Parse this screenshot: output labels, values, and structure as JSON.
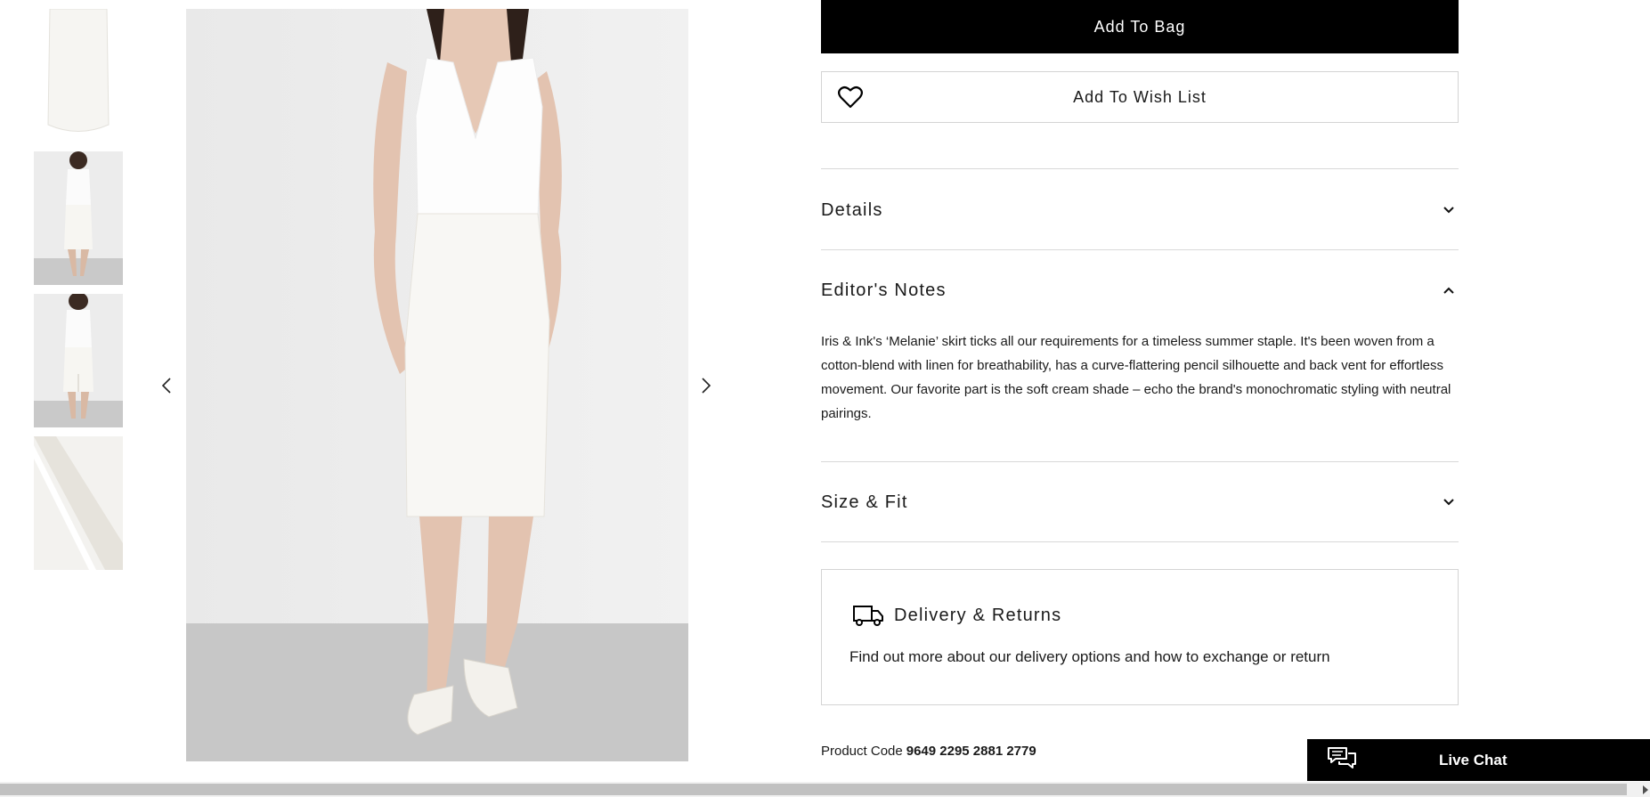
{
  "gallery": {
    "thumbnails": [
      {
        "alt": "skirt front detail"
      },
      {
        "alt": "model front view"
      },
      {
        "alt": "model back view"
      },
      {
        "alt": "fabric close-up"
      }
    ],
    "prev_icon": "chevron-left-icon",
    "next_icon": "chevron-right-icon"
  },
  "actions": {
    "add_to_bag": "Add To Bag",
    "add_to_wish_list": "Add To Wish List",
    "wish_icon": "heart-icon"
  },
  "accordion": {
    "details": {
      "title": "Details",
      "expanded": false
    },
    "editors_notes": {
      "title": "Editor's Notes",
      "expanded": true,
      "body": "Iris & Ink's ‘Melanie’ skirt ticks all our requirements for a timeless summer staple. It's been woven from a cotton-blend with linen for breathability, has a curve-flattering pencil silhouette and back vent for effortless movement. Our favorite part is the soft cream shade – echo the brand's monochromatic styling with neutral pairings."
    },
    "size_fit": {
      "title": "Size & Fit",
      "expanded": false
    }
  },
  "delivery": {
    "title": "Delivery & Returns",
    "text": "Find out more about our delivery options and how to exchange or return",
    "icon": "truck-icon"
  },
  "product_code": {
    "label": "Product Code",
    "value": "9649 2295 2881 2779"
  },
  "chat": {
    "label": "Live Chat",
    "icon": "chat-bubbles-icon"
  },
  "colors": {
    "primary": "#000000",
    "border": "#d4d4d4",
    "background": "#ffffff"
  }
}
